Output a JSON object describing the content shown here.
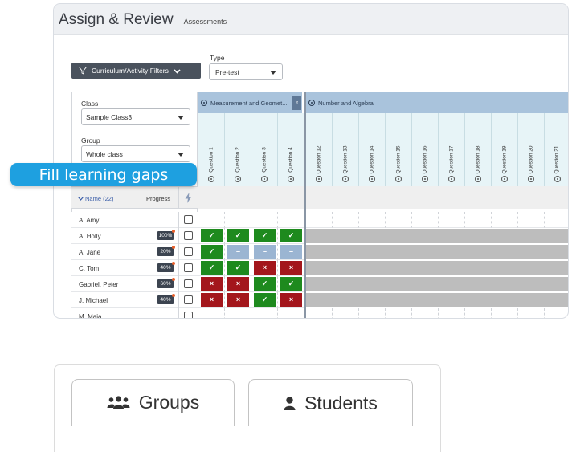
{
  "header": {
    "title": "Assign & Review",
    "subtitle": "Assessments"
  },
  "filters": {
    "curriculum_label": "Curriculum/Activity Filters",
    "type_label": "Type",
    "type_value": "Pre-test"
  },
  "left_panel": {
    "class_label": "Class",
    "class_value": "Sample Class3",
    "group_label": "Group",
    "group_value": "Whole class",
    "name_header": "Name (22)",
    "progress_header": "Progress"
  },
  "strands": [
    {
      "label": "Measurement and Geomet...",
      "collapse": "«"
    },
    {
      "label": "Number and Algebra"
    }
  ],
  "questions": [
    "Question 1",
    "Question 2",
    "Question 3",
    "Question 4",
    "Question 12",
    "Question 13",
    "Question 14",
    "Question 15",
    "Question 16",
    "Question 17",
    "Question 18",
    "Question 19",
    "Question 20",
    "Question 21"
  ],
  "students": [
    {
      "name": "A, Amy",
      "progress": "",
      "marks": [
        "",
        "",
        "",
        ""
      ],
      "graded": false
    },
    {
      "name": "A, Holly",
      "progress": "100%",
      "marks": [
        "✓",
        "✓",
        "✓",
        "✓"
      ],
      "graded": true
    },
    {
      "name": "A, Jane",
      "progress": "20%",
      "marks": [
        "✓",
        "–",
        "–",
        "–"
      ],
      "graded": true
    },
    {
      "name": "C, Tom",
      "progress": "40%",
      "marks": [
        "✓",
        "✓",
        "×",
        "×"
      ],
      "graded": true
    },
    {
      "name": "Gabriel, Peter",
      "progress": "60%",
      "marks": [
        "×",
        "×",
        "✓",
        "✓"
      ],
      "graded": true
    },
    {
      "name": "J, Michael",
      "progress": "40%",
      "marks": [
        "×",
        "×",
        "✓",
        "×"
      ],
      "graded": true
    },
    {
      "name": "M, Maia",
      "progress": "",
      "marks": [
        "",
        "",
        "",
        ""
      ],
      "graded": false
    }
  ],
  "callout": "Fill learning gaps",
  "tabs": [
    {
      "label": "Groups",
      "icon": "users-icon",
      "active": true
    },
    {
      "label": "Students",
      "icon": "user-icon",
      "active": false
    }
  ],
  "colors": {
    "correct": "#1e8a1e",
    "incorrect": "#a3161c",
    "partial": "#9bb5d2",
    "callout": "#1ea0e0",
    "strand_band": "#a9c3dc"
  }
}
